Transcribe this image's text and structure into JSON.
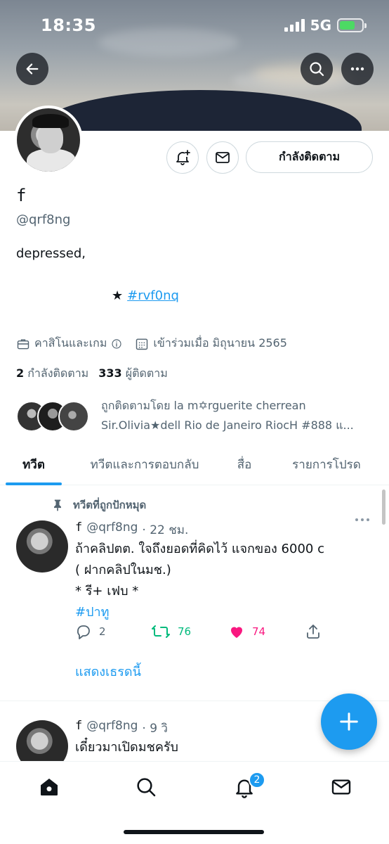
{
  "status": {
    "time": "18:35",
    "network": "5G",
    "battery_level": 0.7,
    "battery_color": "#4cd964"
  },
  "header": {
    "back_icon": "back-arrow-icon",
    "search_icon": "search-icon",
    "more_icon": "more-icon"
  },
  "profile": {
    "name": "f",
    "handle": "@qrf8ng",
    "bio": "depressed,",
    "bio_star": "★",
    "bio_tag": "#rvf0nq",
    "category": "คาสิโนและเกม",
    "joined": "เข้าร่วมเมื่อ มิถุนายน 2565",
    "following_count": "2",
    "following_label": "กำลังติดตาม",
    "followers_count": "333",
    "followers_label": "ผู้ติดตาม",
    "followed_by_line1": "ถูกติดตามโดย la m✡rguerite cherrean",
    "followed_by_line2": "Sir.Olivia★dell Rio de Janeiro RiocH #888 แ..."
  },
  "buttons": {
    "following": "กำลังติดตาม"
  },
  "tabs": [
    "ทวีต",
    "ทวีตและการตอบกลับ",
    "สื่อ",
    "รายการโปรด"
  ],
  "pinned_label": "ทวีตที่ถูกปักหมุด",
  "tweets": [
    {
      "name": "f",
      "handle": "@qrf8ng",
      "time": "· 22 ชม.",
      "line1": "ถ้าคลิปตต. ใจถึงยอดที่คิดไว้  แจกของ 6000 c",
      "line2": "( ฝากคลิปในมช.)",
      "line3": "* รี+ เฟบ *",
      "hashtag": "#ปาทู",
      "replies": "2",
      "retweets": "76",
      "likes": "74",
      "show_thread": "แสดงเธรดนี้"
    },
    {
      "name": "f",
      "handle": "@qrf8ng",
      "time": "· 9 วิ",
      "line1": "เดี๋ยวมาเปิดมชครับ"
    }
  ],
  "colors": {
    "accent": "#1d9bf0",
    "retweet": "#00ba7c",
    "like": "#f91880",
    "secondary_text": "#536471"
  },
  "nav": {
    "notifications_badge": "2"
  }
}
